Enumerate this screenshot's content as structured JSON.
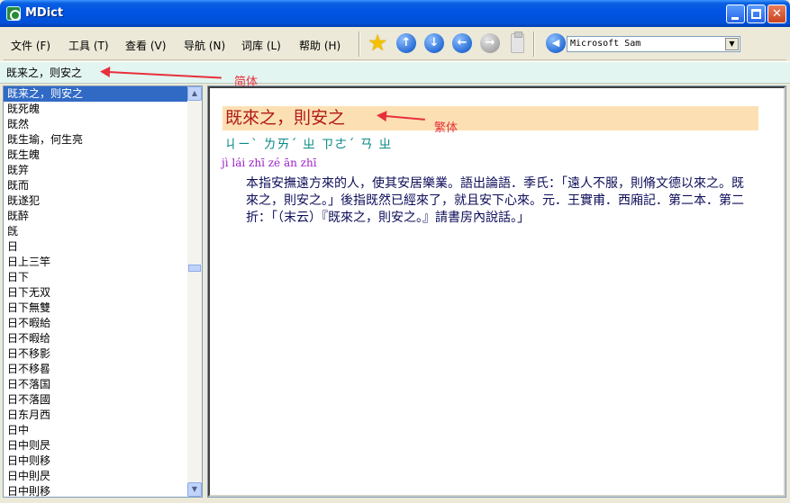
{
  "window": {
    "title": "MDict"
  },
  "menu": [
    {
      "label": "文件 (F)"
    },
    {
      "label": "工具 (T)"
    },
    {
      "label": "查看 (V)"
    },
    {
      "label": "导航 (N)"
    },
    {
      "label": "词库 (L)"
    },
    {
      "label": "帮助 (H)"
    }
  ],
  "toolbar": {
    "voice": "Microsoft Sam",
    "icons": [
      "favorites-star",
      "up-arrow",
      "down-arrow",
      "back-arrow",
      "forward-arrow",
      "clipboard",
      "speaker"
    ]
  },
  "search": {
    "query": "既来之，则安之"
  },
  "annotations": {
    "simplified": "简体",
    "traditional": "繁体"
  },
  "word_list": [
    "既来之，则安之",
    "既死魄",
    "既然",
    "既生瑜，何生亮",
    "既生魄",
    "既笄",
    "既而",
    "既遂犯",
    "既醉",
    "旣",
    "日",
    "日上三竿",
    "日下",
    "日下无双",
    "日下無雙",
    "日不暇給",
    "日不暇给",
    "日不移影",
    "日不移晷",
    "日不落国",
    "日不落國",
    "日东月西",
    "日中",
    "日中则昃",
    "日中则移",
    "日中則昃",
    "日中則移"
  ],
  "entry": {
    "headword": "既來之，則安之",
    "zhuyin": "ㄐㄧˋ ㄌㄞˊ ㄓ ㄗㄜˊ ㄢ ㄓ",
    "pinyin": "jì lái zhī zé ān zhī",
    "definition": "本指安撫遠方來的人，使其安居樂業。語出論語．季氏：「遠人不服，則脩文德以來之。既來之，則安之。」後指既然已經來了，就且安下心來。元．王實甫．西廂記．第二本．第二折：「（末云）『既來之，則安之。』請書房內說話。」"
  },
  "colors": {
    "headword_band": "#fce0b4",
    "headword": "#b01818",
    "zhuyin": "#0a8a86",
    "pinyin": "#9b1fc7",
    "annotation": "#e8303c",
    "selection": "#316ac5"
  }
}
